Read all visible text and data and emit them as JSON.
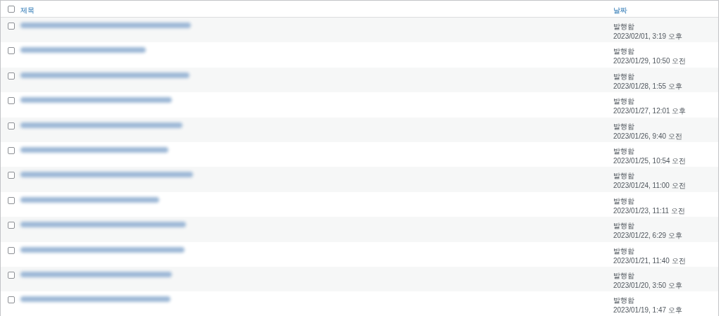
{
  "table": {
    "columns": [
      {
        "label": "제목"
      },
      {
        "label": "날짜"
      }
    ],
    "header_checkbox": {
      "checked": false
    },
    "rows": [
      {
        "checked": false,
        "status": "발행함",
        "date": "2023/02/01, 3:19 오후"
      },
      {
        "checked": false,
        "status": "발행함",
        "date": "2023/01/29, 10:50 오전"
      },
      {
        "checked": false,
        "status": "발행함",
        "date": "2023/01/28, 1:55 오후"
      },
      {
        "checked": false,
        "status": "발행함",
        "date": "2023/01/27, 12:01 오후"
      },
      {
        "checked": false,
        "status": "발행함",
        "date": "2023/01/26, 9:40 오전"
      },
      {
        "checked": false,
        "status": "발행함",
        "date": "2023/01/25, 10:54 오전"
      },
      {
        "checked": false,
        "status": "발행함",
        "date": "2023/01/24, 11:00 오전"
      },
      {
        "checked": false,
        "status": "발행함",
        "date": "2023/01/23, 11:11 오전"
      },
      {
        "checked": false,
        "status": "발행함",
        "date": "2023/01/22, 6:29 오후"
      },
      {
        "checked": false,
        "status": "발행함",
        "date": "2023/01/21, 11:40 오전"
      },
      {
        "checked": false,
        "status": "발행함",
        "date": "2023/01/20, 3:50 오후"
      },
      {
        "checked": false,
        "status": "발행함",
        "date": "2023/01/19, 1:47 오후"
      }
    ]
  }
}
